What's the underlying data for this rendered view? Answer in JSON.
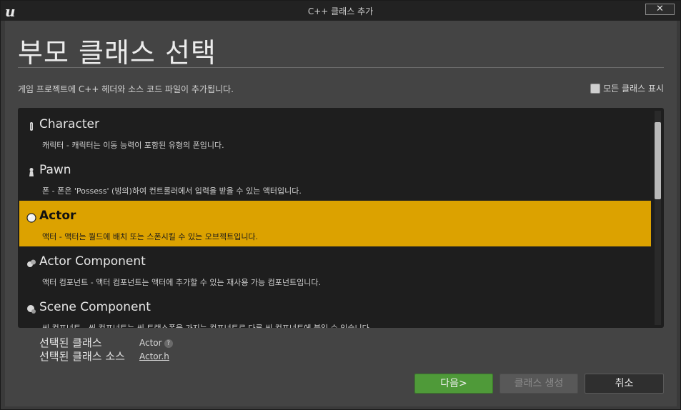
{
  "window": {
    "title": "C++ 클래스 추가",
    "logo_icon": "unreal-logo-icon",
    "close_label": "✕"
  },
  "header": {
    "title": "부모 클래스 선택",
    "subtitle": "게임 프로젝트에 C++ 헤더와 소스 코드 파일이 추가됩니다.",
    "show_all_label": "모든 클래스 표시",
    "show_all_checked": false
  },
  "classes": [
    {
      "name": "Character",
      "description": "캐릭터 - 캐릭터는 이동 능력이 포함된 유형의 폰입니다.",
      "icon": "character-icon",
      "selected": false
    },
    {
      "name": "Pawn",
      "description": "폰 - 폰은 'Possess' (빙의)하여 컨트롤러에서 입력을 받을 수 있는 액터입니다.",
      "icon": "pawn-icon",
      "selected": false
    },
    {
      "name": "Actor",
      "description": "액터 - 액터는 월드에 배치 또는 스폰시킬 수 있는 오브젝트입니다.",
      "icon": "actor-icon",
      "selected": true
    },
    {
      "name": "Actor Component",
      "description": "액터 컴포넌트 - 액터 컴포넌트는 액터에 추가할 수 있는 재사용 가능 컴포넌트입니다.",
      "icon": "actor-component-icon",
      "selected": false
    },
    {
      "name": "Scene Component",
      "description": "씬 컴포넌트 - 씬 컴포넌트는 씬 트랜스폼을 가지는 컴포넌트로 다른 씬 컴포넌트에 붙일 수 있습니다.",
      "icon": "scene-component-icon",
      "selected": false
    }
  ],
  "selection": {
    "class_label": "선택된 클래스",
    "class_value": "Actor",
    "source_label": "선택된 클래스 소스",
    "source_value": "Actor.h",
    "help_glyph": "?"
  },
  "buttons": {
    "next": "다음>",
    "create": "클래스 생성",
    "cancel": "취소"
  },
  "colors": {
    "selected_row": "#dca200",
    "next_button": "#4f9a39"
  }
}
